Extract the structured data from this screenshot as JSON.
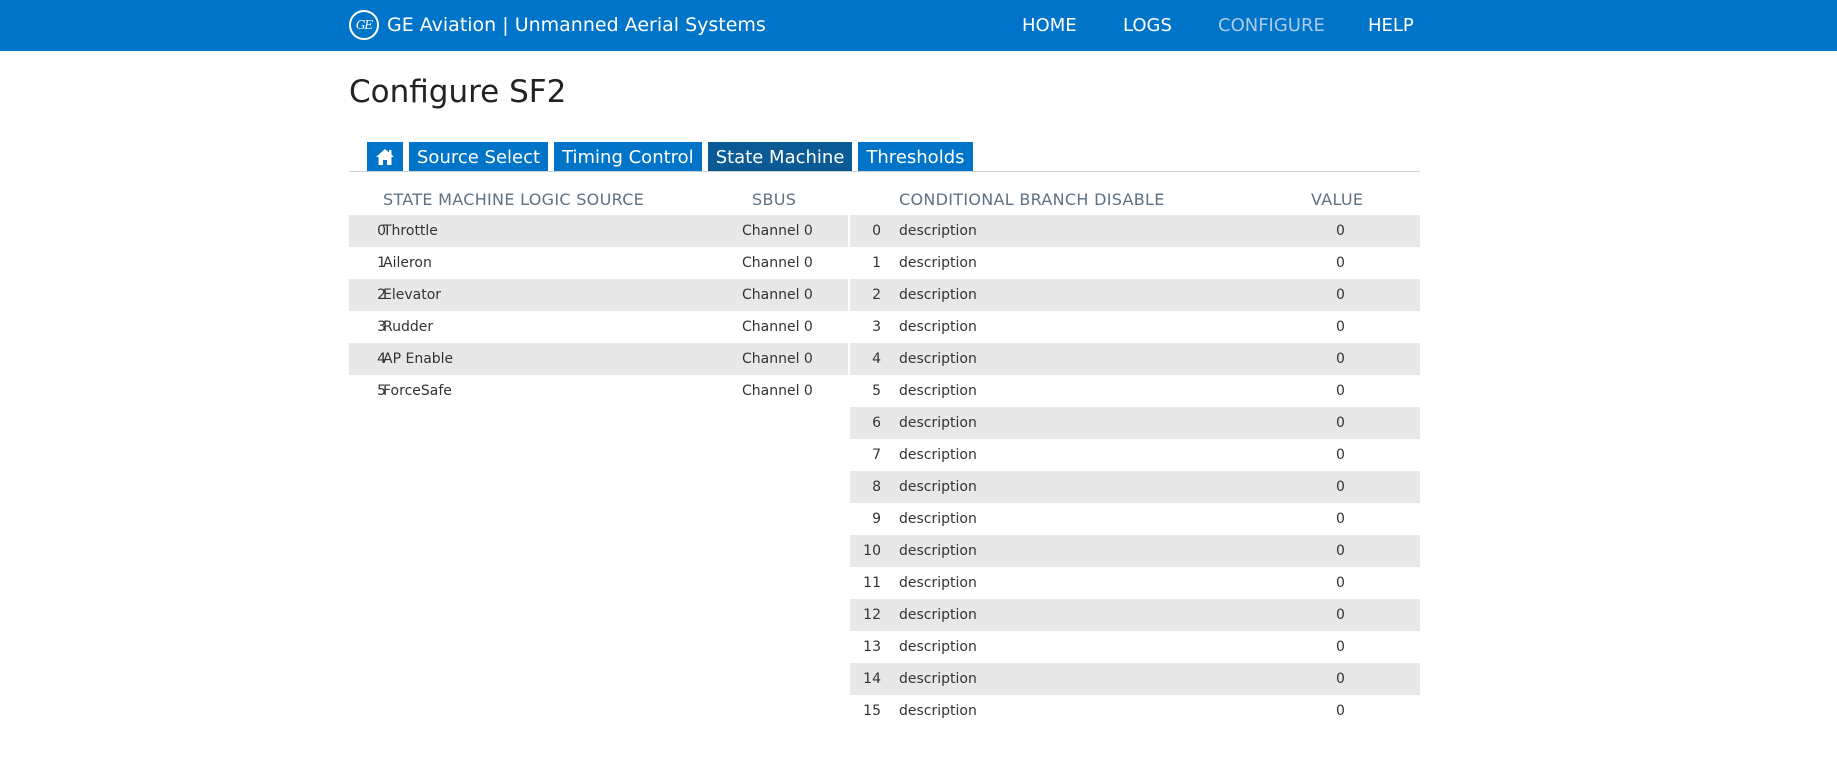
{
  "header": {
    "logo_text": "GE",
    "brand": "GE Aviation | Unmanned Aerial Systems",
    "nav": [
      {
        "label": "HOME",
        "active": false
      },
      {
        "label": "LOGS",
        "active": false
      },
      {
        "label": "CONFIGURE",
        "active": true
      },
      {
        "label": "HELP",
        "active": false
      }
    ]
  },
  "page": {
    "title": "Configure SF2"
  },
  "tabs": [
    {
      "label": "",
      "icon": "home-icon",
      "active": false
    },
    {
      "label": "Source Select",
      "active": false
    },
    {
      "label": "Timing Control",
      "active": false
    },
    {
      "label": "State Machine",
      "active": true
    },
    {
      "label": "Thresholds",
      "active": false
    }
  ],
  "left_table": {
    "headers": {
      "source": "STATE MACHINE LOGIC SOURCE",
      "sbus": "SBUS"
    },
    "rows": [
      {
        "index": "0",
        "name": "Throttle",
        "sbus": "Channel 0"
      },
      {
        "index": "1",
        "name": "Aileron",
        "sbus": "Channel 0"
      },
      {
        "index": "2",
        "name": "Elevator",
        "sbus": "Channel 0"
      },
      {
        "index": "3",
        "name": "Rudder",
        "sbus": "Channel 0"
      },
      {
        "index": "4",
        "name": "AP Enable",
        "sbus": "Channel 0"
      },
      {
        "index": "5",
        "name": "ForceSafe",
        "sbus": "Channel 0"
      }
    ]
  },
  "right_table": {
    "headers": {
      "branch": "CONDITIONAL BRANCH DISABLE",
      "value": "VALUE"
    },
    "rows": [
      {
        "index": "0",
        "description": "description",
        "value": "0"
      },
      {
        "index": "1",
        "description": "description",
        "value": "0"
      },
      {
        "index": "2",
        "description": "description",
        "value": "0"
      },
      {
        "index": "3",
        "description": "description",
        "value": "0"
      },
      {
        "index": "4",
        "description": "description",
        "value": "0"
      },
      {
        "index": "5",
        "description": "description",
        "value": "0"
      },
      {
        "index": "6",
        "description": "description",
        "value": "0"
      },
      {
        "index": "7",
        "description": "description",
        "value": "0"
      },
      {
        "index": "8",
        "description": "description",
        "value": "0"
      },
      {
        "index": "9",
        "description": "description",
        "value": "0"
      },
      {
        "index": "10",
        "description": "description",
        "value": "0"
      },
      {
        "index": "11",
        "description": "description",
        "value": "0"
      },
      {
        "index": "12",
        "description": "description",
        "value": "0"
      },
      {
        "index": "13",
        "description": "description",
        "value": "0"
      },
      {
        "index": "14",
        "description": "description",
        "value": "0"
      },
      {
        "index": "15",
        "description": "description",
        "value": "0"
      }
    ]
  },
  "colors": {
    "brand_blue": "#0074c8",
    "active_tab": "#0a5a96",
    "active_nav": "#a9cbe6",
    "header_text": "#5e7183",
    "row_shade": "#e8e8e8"
  }
}
